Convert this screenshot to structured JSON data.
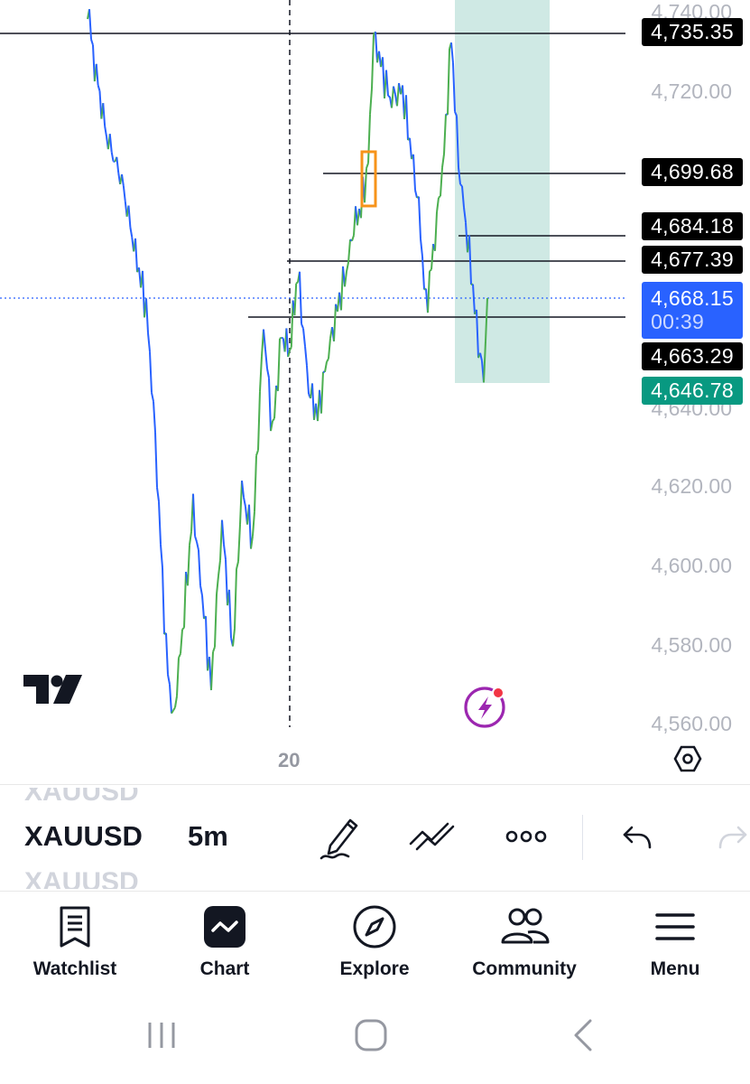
{
  "chart": {
    "y_axis_ticks": [
      "4,740.00",
      "4,720.00",
      "4,640.00",
      "4,620.00",
      "4,600.00",
      "4,580.00",
      "4,560.00"
    ],
    "x_axis_ticks": [
      "20"
    ],
    "price_labels": [
      {
        "text": "4,735.35",
        "kind": "line"
      },
      {
        "text": "4,699.68",
        "kind": "line"
      },
      {
        "text": "4,684.18",
        "kind": "line"
      },
      {
        "text": "4,677.39",
        "kind": "line"
      },
      {
        "text": "4,663.29",
        "kind": "line"
      }
    ],
    "current_price": {
      "text": "4,668.15",
      "countdown": "00:39",
      "color": "#2962ff"
    },
    "target_price": {
      "text": "4,646.78",
      "color": "#089981"
    },
    "colors": {
      "up": "#4caf50",
      "down": "#2962ff",
      "zone": "#cfe9e4",
      "highlight_box": "#f7931a",
      "label_bg": "#000000"
    },
    "logo": "tradingview-logo",
    "alert_icon": "lightning-icon"
  },
  "symbol_bar": {
    "symbol": "XAUUSD",
    "ghost_symbol_top": "XAUUSD",
    "ghost_symbol_bottom": "XAUUSD",
    "timeframe": "5m",
    "icons": [
      "pen-icon",
      "drawing-tools-icon",
      "more-icon",
      "undo-icon",
      "redo-icon"
    ]
  },
  "bottom_nav": {
    "items": [
      {
        "label": "Watchlist",
        "icon": "watchlist-icon"
      },
      {
        "label": "Chart",
        "icon": "chart-icon"
      },
      {
        "label": "Explore",
        "icon": "compass-icon"
      },
      {
        "label": "Community",
        "icon": "community-icon"
      },
      {
        "label": "Menu",
        "icon": "menu-icon"
      }
    ]
  },
  "system_nav": {
    "icons": [
      "recents-icon",
      "home-icon",
      "back-icon"
    ]
  }
}
